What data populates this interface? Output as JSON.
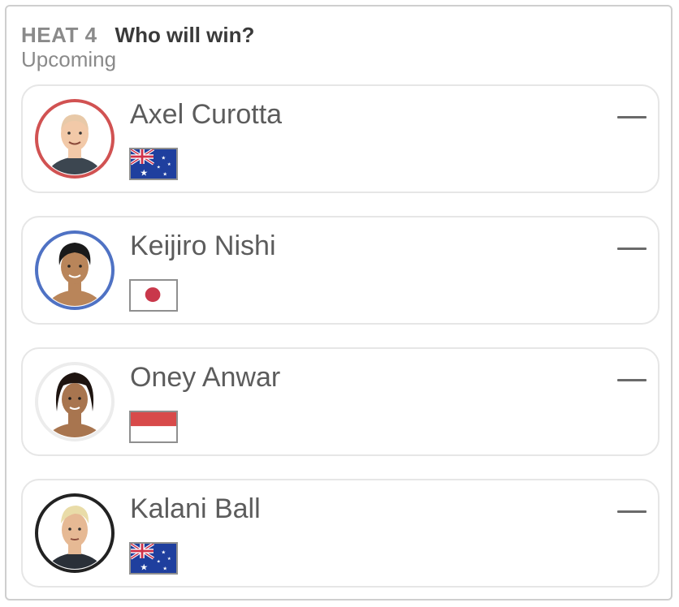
{
  "header": {
    "heat_label": "HEAT 4",
    "question": "Who will win?",
    "status": "Upcoming"
  },
  "surfers": [
    {
      "name": "Axel Curotta",
      "flag": "australia-flag",
      "ring_color": "#d15252",
      "hair_color": "#e8c9a8",
      "skin_color": "#f2c9a8",
      "status_symbol": "—"
    },
    {
      "name": "Keijiro Nishi",
      "flag": "japan-flag",
      "ring_color": "#4f72c4",
      "hair_color": "#1a1a1a",
      "skin_color": "#b9855a",
      "status_symbol": "—"
    },
    {
      "name": "Oney Anwar",
      "flag": "indonesia-flag",
      "ring_color": "#ececec",
      "hair_color": "#1e1410",
      "skin_color": "#a8754f",
      "status_symbol": "—"
    },
    {
      "name": "Kalani Ball",
      "flag": "australia-flag",
      "ring_color": "#222222",
      "hair_color": "#e9dca8",
      "skin_color": "#e6b994",
      "status_symbol": "—"
    }
  ],
  "colors": {
    "australia_blue": "#1f3f9e",
    "japan_red": "#c9384b",
    "indonesia_red": "#d84a4a"
  }
}
